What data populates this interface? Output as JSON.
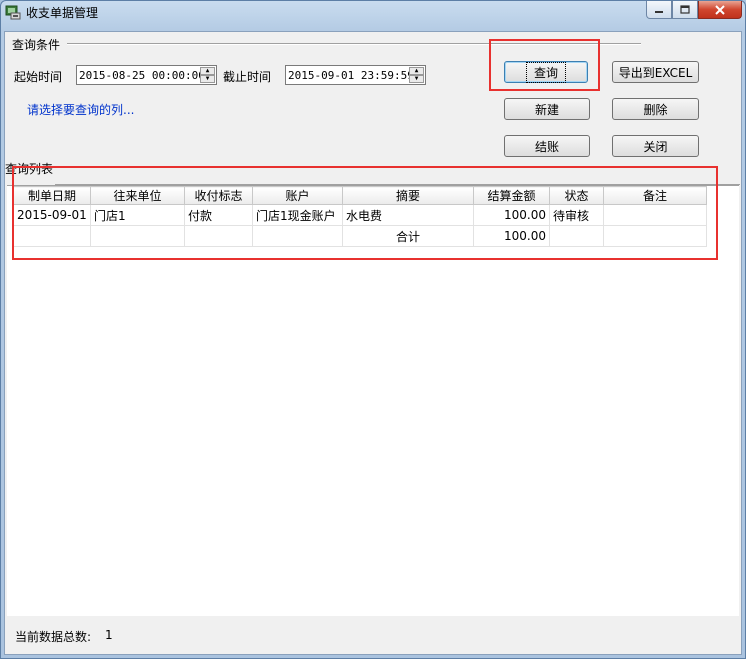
{
  "window": {
    "title": "收支单据管理"
  },
  "query": {
    "group_label": "查询条件",
    "start_label": "起始时间",
    "start_value": "2015-08-25 00:00:00",
    "end_label": "截止时间",
    "end_value": "2015-09-01 23:59:59",
    "hint": "请选择要查询的列..."
  },
  "buttons": {
    "query": "查询",
    "export": "导出到EXCEL",
    "new": "新建",
    "delete": "删除",
    "settle": "结账",
    "close": "关闭"
  },
  "list": {
    "label": "查询列表",
    "columns": [
      "制单日期",
      "往来单位",
      "收付标志",
      "账户",
      "摘要",
      "结算金额",
      "状态",
      "备注"
    ],
    "rows": [
      [
        "2015-09-01",
        "门店1",
        "付款",
        "门店1现金账户",
        "水电费",
        "100.00",
        "待审核",
        ""
      ],
      [
        "",
        "",
        "",
        "",
        "合计",
        "100.00",
        "",
        ""
      ]
    ]
  },
  "status": {
    "count_label": "当前数据总数:",
    "count_value": "1"
  },
  "colors": {
    "highlight": "#e8312f",
    "hint": "#0033cc"
  }
}
